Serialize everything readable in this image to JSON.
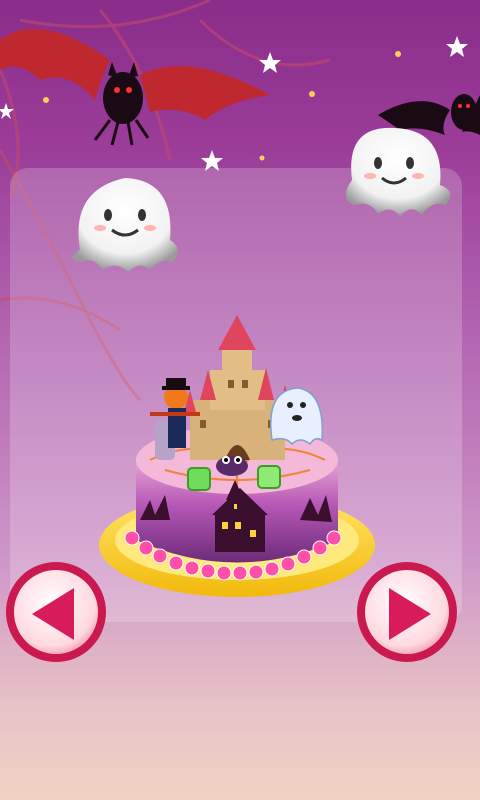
{
  "screen": {
    "name": "halloween-cake-viewer"
  },
  "colors": {
    "bg_top": "#8a2d8a",
    "bg_bottom": "#f0d3c4",
    "bat": "#1a0a14",
    "bat_wing": "#c0282f",
    "ghost": "#ffffff",
    "button_ring": "#c9194f",
    "button_fill": "#ffe6ea",
    "arrow": "#d81b5a",
    "plate": "#f7d81e",
    "cake_side": "#b04fb0",
    "castle": "#d8b27a"
  },
  "icons": {
    "prev": "arrow-left-icon",
    "next": "arrow-right-icon"
  }
}
